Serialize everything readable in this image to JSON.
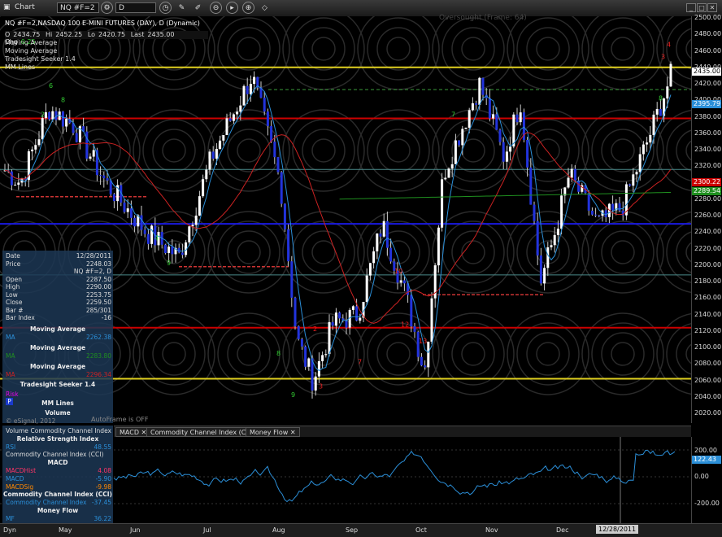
{
  "toolbar": {
    "title": "Chart",
    "symbol": "NQ #F=2",
    "interval": "D"
  },
  "chart": {
    "legend_title": "NQ #F=2,NASDAQ 100 E-MINI FUTURES (DAY), D (Dynamic)",
    "legend_lines": [
      "Moving Average",
      "Moving Average",
      "Tradesight Seeker 1.4",
      "MM Lines"
    ],
    "ohlc": {
      "o_label": "O",
      "o": "2434.75",
      "h_label": "Hi",
      "h": "2452.25",
      "l_label": "Lo",
      "l": "2420.75",
      "c_label": "Last",
      "c": "2435.00",
      "chg_label": "Chg",
      "chg": "0.25"
    },
    "overlay_text": "Oversought (Frame: 64)",
    "autoframe": "AutoFrame is OFF"
  },
  "price_axis": [
    "2500.00",
    "2480.00",
    "2460.00",
    "2440.00",
    "2420.00",
    "2400.00",
    "2380.00",
    "2360.00",
    "2340.00",
    "2320.00",
    "2300.00",
    "2280.00",
    "2260.00",
    "2240.00",
    "2220.00",
    "2200.00",
    "2180.00",
    "2160.00",
    "2140.00",
    "2120.00",
    "2100.00",
    "2080.00",
    "2060.00",
    "2040.00",
    "2020.00"
  ],
  "price_tags": [
    {
      "text": "2435.00",
      "bg": "#ffffff",
      "fg": "#000000",
      "value": 2435.0
    },
    {
      "text": "2395.79",
      "bg": "#2b8fd8",
      "fg": "#ffffff",
      "value": 2395.79
    },
    {
      "text": "2300.22",
      "bg": "#cc0000",
      "fg": "#ffffff",
      "value": 2300.22
    },
    {
      "text": "2289.54",
      "bg": "#1f8f1f",
      "fg": "#ffffff",
      "value": 2289.54
    }
  ],
  "data_window": {
    "rows": [
      {
        "k": "Date",
        "v": "12/28/2011"
      },
      {
        "k": "Price",
        "v": "2248.03"
      },
      {
        "k": "",
        "v": "NQ #F=2, D"
      },
      {
        "k": "Open",
        "v": "2287.50"
      },
      {
        "k": "High",
        "v": "2290.00"
      },
      {
        "k": "Low",
        "v": "2253.75"
      },
      {
        "k": "Close",
        "v": "2259.50"
      },
      {
        "k": "Bar #",
        "v": "285/301"
      },
      {
        "k": "Bar Index",
        "v": "-16"
      }
    ],
    "sections": [
      {
        "title": "Moving Average",
        "k": "MA",
        "v": "2262.38",
        "color": "#2b8fd8"
      },
      {
        "title": "Moving Average",
        "k": "MA",
        "v": "2283.80",
        "color": "#1f8f1f"
      },
      {
        "title": "Moving Average",
        "k": "MA",
        "v": "2296.34",
        "color": "#cc2222"
      }
    ],
    "seeker_title": "Tradesight Seeker 1.4",
    "risk_label": "Risk",
    "p_label": "P",
    "mm_title": "MM Lines",
    "volume_title": "Volume",
    "copyright": "© eSignal, 2012"
  },
  "lower_panel": {
    "rows": [
      {
        "k": "Volume",
        "v": "Commodity Channel Index",
        "c": "#ddd"
      },
      {
        "k": "Relative Strength Index",
        "v": "",
        "c": "#fff"
      },
      {
        "k": "RSI",
        "v": "48.55",
        "c": "#2b8fd8"
      },
      {
        "k": "Commodity Channel Index (CCI)",
        "v": "",
        "c": "#ddd"
      },
      {
        "k": "MACD",
        "v": "",
        "c": "#fff"
      },
      {
        "k": "MACDHist",
        "v": "4.08",
        "c": "#ff3366"
      },
      {
        "k": "MACD",
        "v": "-5.90",
        "c": "#2b8fd8"
      },
      {
        "k": "MACDSig",
        "v": "-9.98",
        "c": "#ff8800"
      },
      {
        "k": "Commodity Channel Index (CCI)",
        "v": "",
        "c": "#fff"
      },
      {
        "k": "Commodity Channel Index",
        "v": "-37.45",
        "c": "#2b8fd8"
      },
      {
        "k": "Money Flow",
        "v": "",
        "c": "#fff"
      },
      {
        "k": "MF",
        "v": "36.22",
        "c": "#2b8fd8"
      }
    ],
    "axis": [
      "200.00",
      "0.00",
      "-200.00"
    ],
    "cci_tag": "122.43"
  },
  "tabs": [
    "MACD",
    "Commodity Channel Index (CCI)",
    "Money Flow"
  ],
  "date_axis": {
    "dyn": "Dyn",
    "months": [
      "May",
      "Jun",
      "Jul",
      "Aug",
      "Sep",
      "Oct",
      "Nov",
      "Dec"
    ],
    "current": "12/28/2011"
  },
  "colors": {
    "accent": "#2b8fd8",
    "sma_red": "#cc2222",
    "sma_green": "#1f8f1f",
    "hline_yellow": "#e0d020",
    "hline_red": "#cc0000",
    "hline_blue": "#1a1ae0",
    "hline_teal": "#4a8a8a"
  }
}
